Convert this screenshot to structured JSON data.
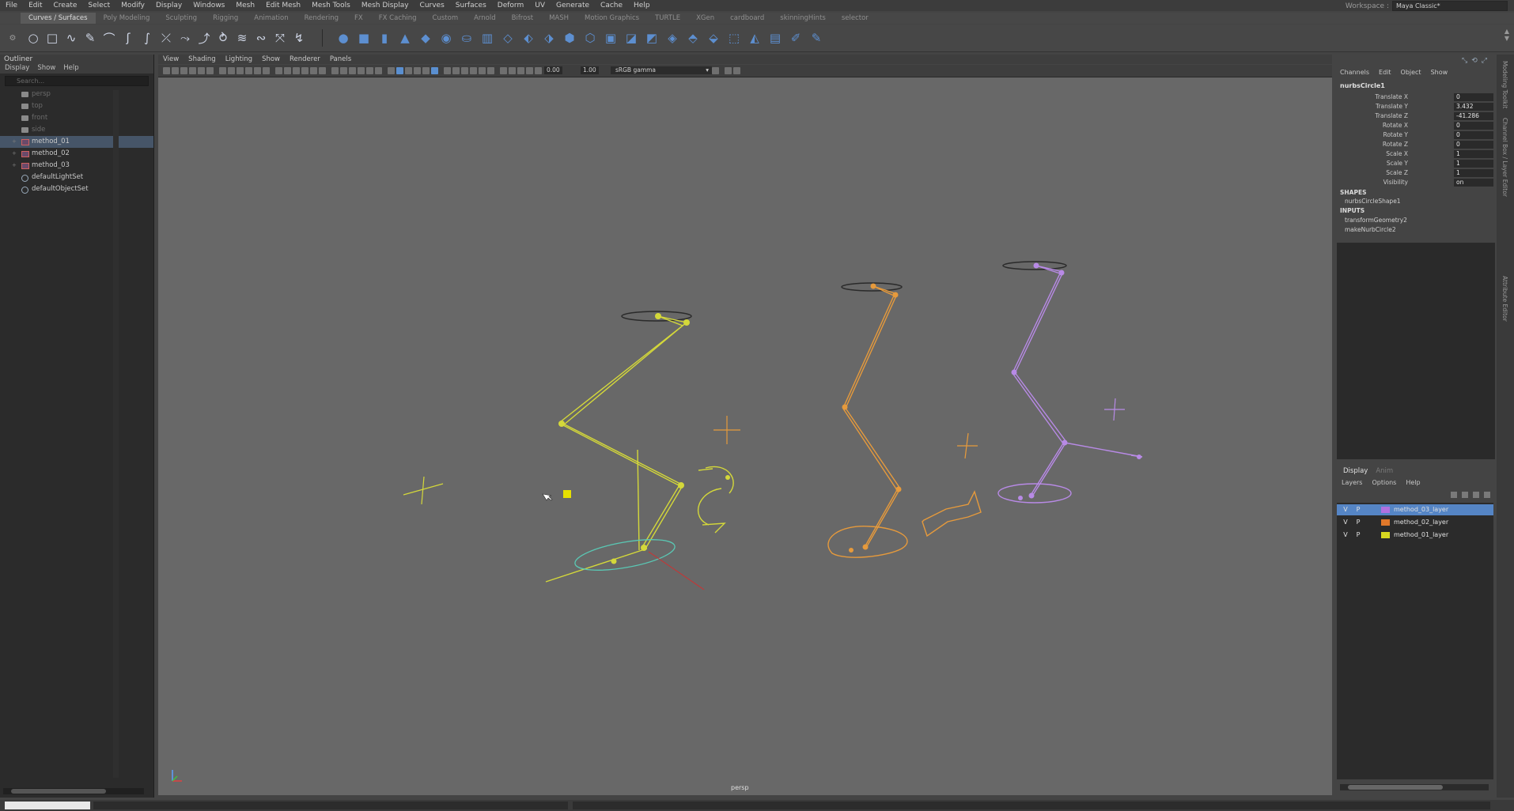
{
  "menubar": {
    "items": [
      "File",
      "Edit",
      "Create",
      "Select",
      "Modify",
      "Display",
      "Windows",
      "Mesh",
      "Edit Mesh",
      "Mesh Tools",
      "Mesh Display",
      "Curves",
      "Surfaces",
      "Deform",
      "UV",
      "Generate",
      "Cache",
      "Help"
    ],
    "workspace_label": "Workspace :",
    "workspace_value": "Maya Classic*"
  },
  "shelf_tabs": [
    "Curves / Surfaces",
    "Poly Modeling",
    "Sculpting",
    "Rigging",
    "Animation",
    "Rendering",
    "FX",
    "FX Caching",
    "Custom",
    "Arnold",
    "Bifrost",
    "MASH",
    "Motion Graphics",
    "TURTLE",
    "XGen",
    "cardboard",
    "skinningHints",
    "selector"
  ],
  "outliner": {
    "title": "Outliner",
    "menus": [
      "Display",
      "Show",
      "Help"
    ],
    "search_placeholder": "Search...",
    "items": [
      {
        "label": "persp",
        "style": "camera",
        "dim": true
      },
      {
        "label": "top",
        "style": "camera",
        "dim": true
      },
      {
        "label": "front",
        "style": "camera",
        "dim": true
      },
      {
        "label": "side",
        "style": "camera",
        "dim": true
      },
      {
        "label": "method_01",
        "style": "group",
        "expand": "+",
        "selected": true
      },
      {
        "label": "method_02",
        "style": "group",
        "expand": "+"
      },
      {
        "label": "method_03",
        "style": "group",
        "expand": "+"
      },
      {
        "label": "defaultLightSet",
        "style": "set"
      },
      {
        "label": "defaultObjectSet",
        "style": "set"
      }
    ]
  },
  "viewport": {
    "menus": [
      "View",
      "Shading",
      "Lighting",
      "Show",
      "Renderer",
      "Panels"
    ],
    "field_a": "0.00",
    "field_b": "1.00",
    "color_management": "sRGB gamma",
    "camera_label": "persp"
  },
  "channel_box": {
    "menus": [
      "Channels",
      "Edit",
      "Object",
      "Show"
    ],
    "object_name": "nurbsCircle1",
    "attributes": [
      {
        "name": "Translate X",
        "value": "0"
      },
      {
        "name": "Translate Y",
        "value": "3.432"
      },
      {
        "name": "Translate Z",
        "value": "-41.286"
      },
      {
        "name": "Rotate X",
        "value": "0"
      },
      {
        "name": "Rotate Y",
        "value": "0"
      },
      {
        "name": "Rotate Z",
        "value": "0"
      },
      {
        "name": "Scale X",
        "value": "1"
      },
      {
        "name": "Scale Y",
        "value": "1"
      },
      {
        "name": "Scale Z",
        "value": "1"
      },
      {
        "name": "Visibility",
        "value": "on"
      }
    ],
    "shapes_header": "SHAPES",
    "shape_node": "nurbsCircleShape1",
    "inputs_header": "INPUTS",
    "input_nodes": [
      "transformGeometry2",
      "makeNurbCircle2"
    ]
  },
  "layer_editor": {
    "tabs": [
      "Display",
      "Anim"
    ],
    "menus": [
      "Layers",
      "Options",
      "Help"
    ],
    "layers": [
      {
        "v": "V",
        "p": "P",
        "name": "method_03_layer",
        "color": "#b070e0",
        "selected": true
      },
      {
        "v": "V",
        "p": "P",
        "name": "method_02_layer",
        "color": "#e0782a"
      },
      {
        "v": "V",
        "p": "P",
        "name": "method_01_layer",
        "color": "#d8d820"
      }
    ]
  },
  "right_strip": [
    "Modeling Toolkit",
    "Channel Box / Layer Editor",
    "Attribute Editor"
  ],
  "colors": {
    "method_01": "#d4d83a",
    "method_02": "#e69a3c",
    "method_03": "#b88ae6",
    "selection": "#5585c5"
  }
}
